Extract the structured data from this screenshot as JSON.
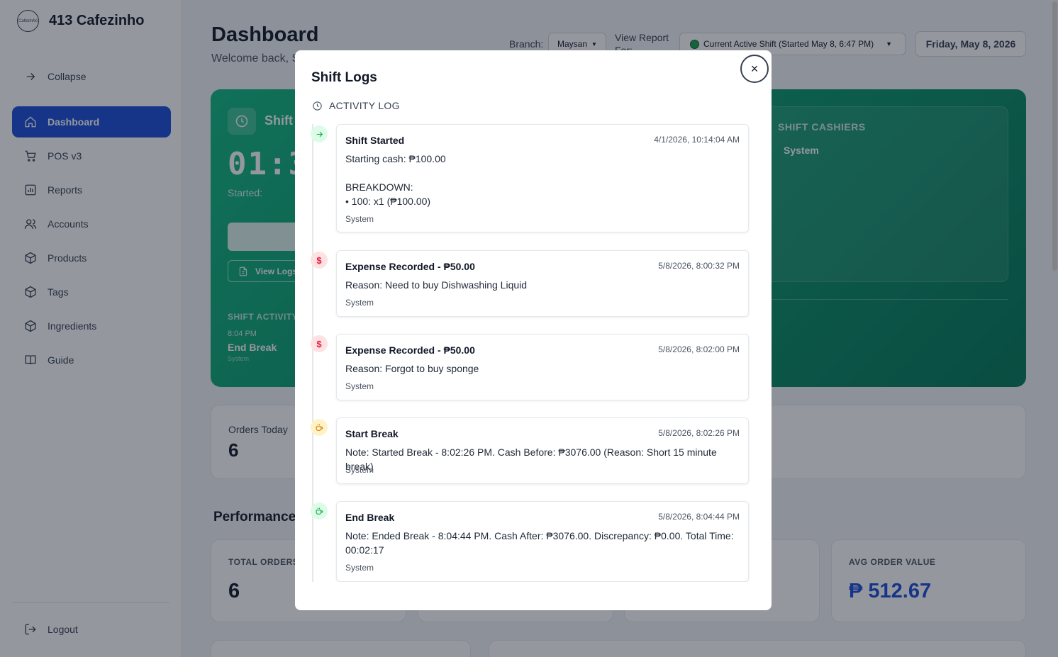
{
  "brand": {
    "name": "413 Cafezinho",
    "logo_text": "Cafezinho"
  },
  "sidebar": {
    "items": [
      {
        "label": "Collapse",
        "icon": "arrow-right-icon"
      },
      {
        "label": "Dashboard",
        "icon": "home-icon",
        "active": true
      },
      {
        "label": "POS v3",
        "icon": "cart-icon"
      },
      {
        "label": "Reports",
        "icon": "chart-icon"
      },
      {
        "label": "Accounts",
        "icon": "users-icon"
      },
      {
        "label": "Products",
        "icon": "box-icon"
      },
      {
        "label": "Tags",
        "icon": "box-icon"
      },
      {
        "label": "Ingredients",
        "icon": "box-icon"
      },
      {
        "label": "Guide",
        "icon": "book-icon"
      }
    ],
    "logout": "Logout"
  },
  "header": {
    "title": "Dashboard",
    "subtitle": "Welcome back, S",
    "branch_label": "Branch:",
    "branch_value": "Maysan",
    "report_label": "View Report For:",
    "shift_value": "Current Active Shift (Started May 8, 6:47 PM)",
    "date": "Friday, May 8, 2026"
  },
  "shift_card": {
    "title": "Shift",
    "timer": "01:3",
    "started_label": "Started:",
    "view_logs": "View Logs",
    "activity_label": "SHIFT ACTIVITY",
    "last_activity_time": "8:04 PM",
    "last_activity_event": "End Break",
    "last_activity_user": "System",
    "cashiers_label": "SHIFT CASHIERS",
    "cashier": "System"
  },
  "orders_today": {
    "label": "Orders Today",
    "value": "6"
  },
  "performance": {
    "title": "Performance",
    "total_orders_label": "TOTAL ORDERS",
    "total_orders_value": "6",
    "avg_order_label": "AVG ORDER VALUE",
    "avg_order_value": "₱ 512.67"
  },
  "modal": {
    "title": "Shift Logs",
    "close": "×",
    "activity_heading": "ACTIVITY LOG",
    "logs": [
      {
        "title": "Shift Started",
        "time": "4/1/2026, 10:14:04 AM",
        "body": "Starting cash: ₱100.00\n\nBREAKDOWN:\n• 100: x1 (₱100.00)",
        "user": "System",
        "kind": "start"
      },
      {
        "title": "Expense Recorded - ₱50.00",
        "time": "5/8/2026, 8:00:32 PM",
        "body": "Reason: Need to buy Dishwashing Liquid",
        "user": "System",
        "kind": "expense"
      },
      {
        "title": "Expense Recorded - ₱50.00",
        "time": "5/8/2026, 8:02:00 PM",
        "body": "Reason: Forgot to buy sponge",
        "user": "System",
        "kind": "expense"
      },
      {
        "title": "Start Break",
        "time": "5/8/2026, 8:02:26 PM",
        "body": "Note: Started Break - 8:02:26 PM. Cash Before: ₱3076.00 (Reason: Short 15 minute break)",
        "user": "System",
        "kind": "break-start"
      },
      {
        "title": "End Break",
        "time": "5/8/2026, 8:04:44 PM",
        "body": "Note: Ended Break - 8:04:44 PM. Cash After: ₱3076.00. Discrepancy: ₱0.00. Total Time: 00:02:17",
        "user": "System",
        "kind": "break-end"
      }
    ]
  }
}
